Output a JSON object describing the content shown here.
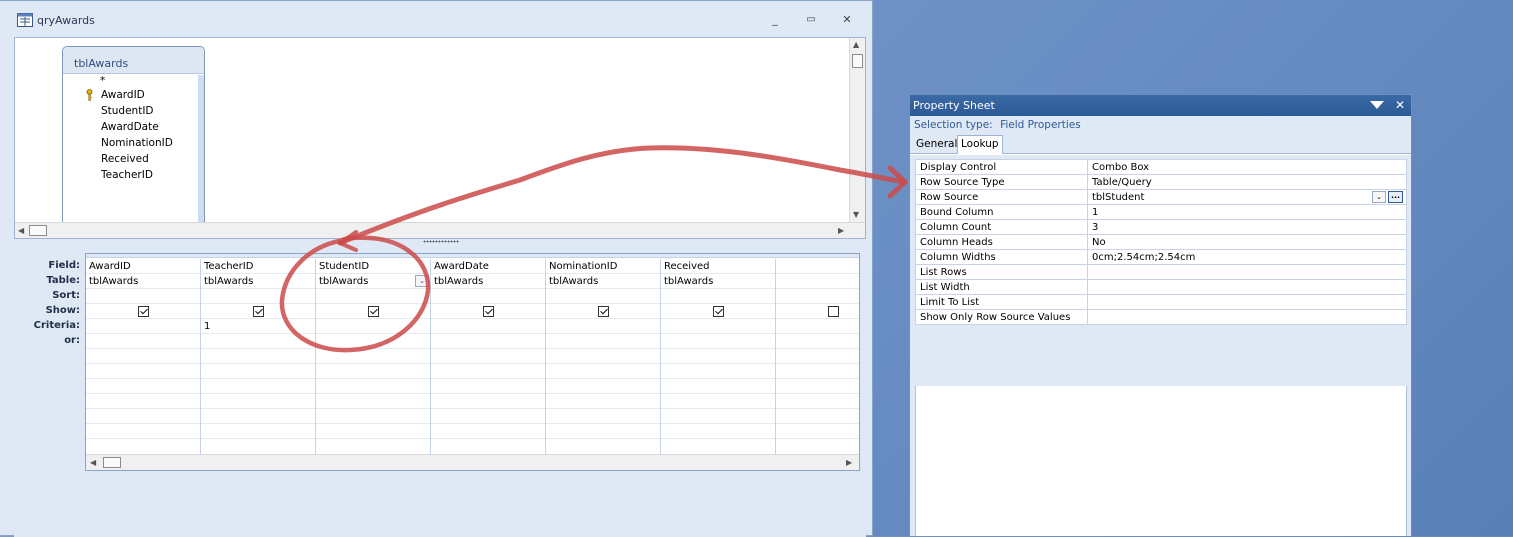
{
  "window": {
    "title": "qryAwards",
    "minimize": "_",
    "maximize": "▭",
    "close": "✕"
  },
  "table": {
    "name": "tblAwards",
    "fields": [
      "*",
      "AwardID",
      "StudentID",
      "AwardDate",
      "NominationID",
      "Received",
      "TeacherID"
    ],
    "key_field": "AwardID"
  },
  "grid": {
    "row_labels": [
      "Field:",
      "Table:",
      "Sort:",
      "Show:",
      "Criteria:",
      "or:"
    ],
    "columns": [
      {
        "field": "AwardID",
        "table": "tblAwards",
        "sort": "",
        "show": true,
        "criteria": "",
        "or": ""
      },
      {
        "field": "TeacherID",
        "table": "tblAwards",
        "sort": "",
        "show": true,
        "criteria": "1",
        "or": ""
      },
      {
        "field": "StudentID",
        "table": "tblAwards",
        "sort": "",
        "show": true,
        "criteria": "",
        "or": "",
        "has_dropdown": true
      },
      {
        "field": "AwardDate",
        "table": "tblAwards",
        "sort": "",
        "show": true,
        "criteria": "",
        "or": ""
      },
      {
        "field": "NominationID",
        "table": "tblAwards",
        "sort": "",
        "show": true,
        "criteria": "",
        "or": ""
      },
      {
        "field": "Received",
        "table": "tblAwards",
        "sort": "",
        "show": true,
        "criteria": "",
        "or": ""
      },
      {
        "field": "",
        "table": "",
        "sort": "",
        "show": false,
        "criteria": "",
        "or": ""
      }
    ]
  },
  "property_sheet": {
    "title": "Property Sheet",
    "selection_type_label": "Selection type:",
    "selection_type_value": "Field Properties",
    "tabs": [
      "General",
      "Lookup"
    ],
    "active_tab": "Lookup",
    "properties": [
      {
        "name": "Display Control",
        "value": "Combo Box"
      },
      {
        "name": "Row Source Type",
        "value": "Table/Query"
      },
      {
        "name": "Row Source",
        "value": "tblStudent"
      },
      {
        "name": "Bound Column",
        "value": "1"
      },
      {
        "name": "Column Count",
        "value": "3"
      },
      {
        "name": "Column Heads",
        "value": "No"
      },
      {
        "name": "Column Widths",
        "value": "0cm;2.54cm;2.54cm"
      },
      {
        "name": "List Rows",
        "value": ""
      },
      {
        "name": "List Width",
        "value": ""
      },
      {
        "name": "Limit To List",
        "value": ""
      },
      {
        "name": "Show Only Row Source Values",
        "value": ""
      }
    ],
    "build_button": "...",
    "dropdown_glyph": "⌄"
  },
  "colors": {
    "annotation": "#cc4a4a",
    "titlebar": "#2c5a97",
    "pane_bg": "#dfe8f5"
  }
}
